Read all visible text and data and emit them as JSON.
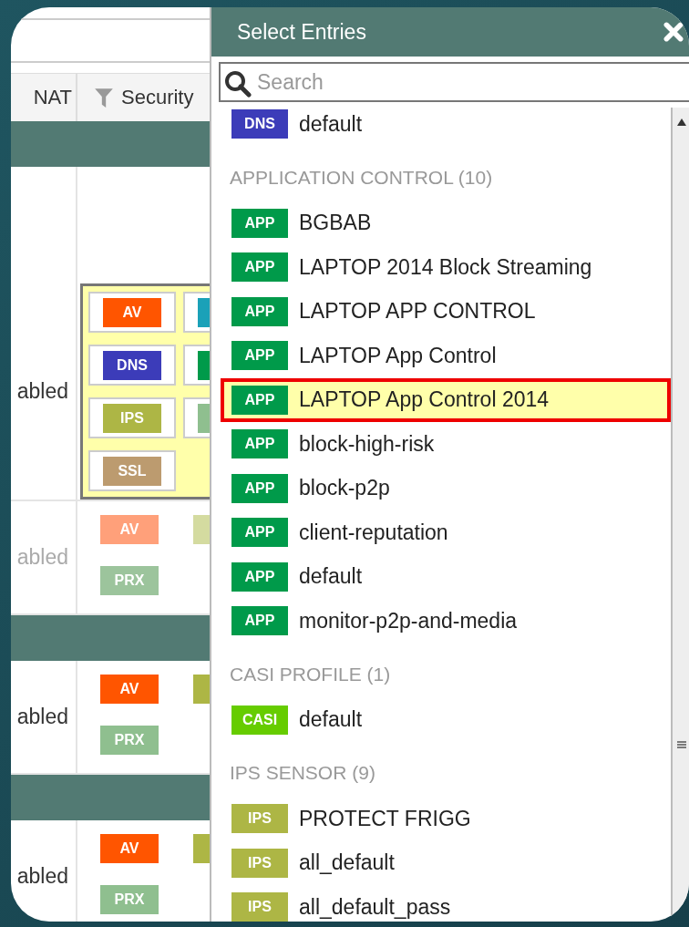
{
  "table": {
    "columns": [
      {
        "label": "NAT",
        "filter": false
      },
      {
        "label": "Security",
        "filter": true
      }
    ],
    "rows": [
      {
        "kind": "group"
      },
      {
        "kind": "policy",
        "status": "abled",
        "disabled": false,
        "highlighted": true,
        "badges": [
          {
            "label": "AV",
            "color": "#ff5500"
          },
          {
            "color": "#1ba1b8"
          },
          {
            "label": "DNS",
            "color": "#3c3cb9"
          },
          {
            "color": "#009a4a"
          },
          {
            "label": "IPS",
            "color": "#adb645"
          },
          {
            "color": "#8fbf8f"
          },
          {
            "label": "SSL",
            "color": "#bc9b6f"
          }
        ]
      },
      {
        "kind": "policy",
        "status": "abled",
        "disabled": true,
        "highlighted": false,
        "badges": [
          {
            "label": "AV",
            "color": "#ffa07a"
          },
          {
            "color": "#d4dba0"
          },
          {
            "label": "PRX",
            "color": "#9cc49c"
          }
        ]
      },
      {
        "kind": "group"
      },
      {
        "kind": "policy",
        "status": "abled",
        "disabled": false,
        "highlighted": false,
        "badges": [
          {
            "label": "AV",
            "color": "#ff5500"
          },
          {
            "color": "#adb645"
          },
          {
            "label": "PRX",
            "color": "#8fbf8f"
          }
        ]
      },
      {
        "kind": "group"
      },
      {
        "kind": "policy",
        "status": "abled",
        "disabled": false,
        "highlighted": false,
        "badges": [
          {
            "label": "AV",
            "color": "#ff5500"
          },
          {
            "color": "#adb645"
          },
          {
            "label": "PRX",
            "color": "#8fbf8f"
          }
        ]
      }
    ]
  },
  "dialog": {
    "title": "Select Entries",
    "search": {
      "placeholder": "Search"
    },
    "entries": [
      {
        "kind": "entry",
        "tag": "DNS",
        "color": "#3c3cb9",
        "label": "default",
        "selected": false
      },
      {
        "kind": "section",
        "label": "APPLICATION CONTROL (10)"
      },
      {
        "kind": "entry",
        "tag": "APP",
        "color": "#009a4a",
        "label": "BGBAB",
        "selected": false
      },
      {
        "kind": "entry",
        "tag": "APP",
        "color": "#009a4a",
        "label": "LAPTOP 2014 Block Streaming",
        "selected": false
      },
      {
        "kind": "entry",
        "tag": "APP",
        "color": "#009a4a",
        "label": "LAPTOP APP CONTROL",
        "selected": false
      },
      {
        "kind": "entry",
        "tag": "APP",
        "color": "#009a4a",
        "label": "LAPTOP App Control",
        "selected": false
      },
      {
        "kind": "entry",
        "tag": "APP",
        "color": "#009a4a",
        "label": "LAPTOP App Control 2014",
        "selected": true
      },
      {
        "kind": "entry",
        "tag": "APP",
        "color": "#009a4a",
        "label": "block-high-risk",
        "selected": false
      },
      {
        "kind": "entry",
        "tag": "APP",
        "color": "#009a4a",
        "label": "block-p2p",
        "selected": false
      },
      {
        "kind": "entry",
        "tag": "APP",
        "color": "#009a4a",
        "label": "client-reputation",
        "selected": false
      },
      {
        "kind": "entry",
        "tag": "APP",
        "color": "#009a4a",
        "label": "default",
        "selected": false
      },
      {
        "kind": "entry",
        "tag": "APP",
        "color": "#009a4a",
        "label": "monitor-p2p-and-media",
        "selected": false
      },
      {
        "kind": "section",
        "label": "CASI PROFILE (1)"
      },
      {
        "kind": "entry",
        "tag": "CASI",
        "color": "#66cc00",
        "label": "default",
        "selected": false
      },
      {
        "kind": "section",
        "label": "IPS SENSOR (9)"
      },
      {
        "kind": "entry",
        "tag": "IPS",
        "color": "#adb645",
        "label": "PROTECT FRIGG",
        "selected": false
      },
      {
        "kind": "entry",
        "tag": "IPS",
        "color": "#adb645",
        "label": "all_default",
        "selected": false
      },
      {
        "kind": "entry",
        "tag": "IPS",
        "color": "#adb645",
        "label": "all_default_pass",
        "selected": false
      }
    ]
  }
}
